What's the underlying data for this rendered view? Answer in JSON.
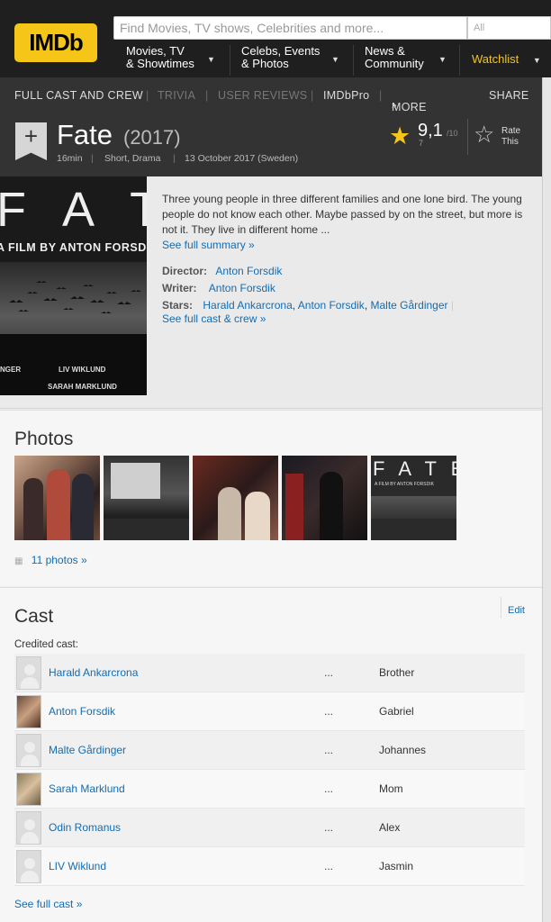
{
  "header": {
    "logo": "IMDb",
    "search_placeholder": "Find Movies, TV shows, Celebrities and more...",
    "search_category": "All",
    "nav": [
      {
        "line1": "Movies, TV",
        "line2": "& Showtimes"
      },
      {
        "line1": "Celebs, Events",
        "line2": "& Photos"
      },
      {
        "line1": "News &",
        "line2": "Community"
      }
    ],
    "watchlist": "Watchlist"
  },
  "subnav": {
    "full_cast": "FULL CAST AND CREW",
    "trivia": "TRIVIA",
    "user_reviews": "USER REVIEWS",
    "imdbpro": "IMDbPro",
    "more": "MORE",
    "share": "SHARE"
  },
  "title": {
    "name": "Fate",
    "year": "(2017)",
    "runtime": "16min",
    "genres": "Short, Drama",
    "release": "13 October 2017 (Sweden)",
    "rating": "9,1",
    "rating_max": "/10",
    "rating_count": "7",
    "rate_line1": "Rate",
    "rate_line2": "This"
  },
  "poster": {
    "title_letters": "F A T",
    "tagline": "A FILM BY ANTON FORSDI",
    "credit1": "NGER",
    "credit2": "LIV WIKLUND",
    "credit3": "SARAH MARKLUND"
  },
  "overview": {
    "summary": "Three young people in three different families and one lone bird. The young people do not know each other. Maybe passed by on the street, but more is not it. They live in different home ...",
    "see_summary": "See full summary »",
    "director_label": "Director:",
    "director": "Anton Forsdik",
    "writer_label": "Writer:",
    "writer": "Anton Forsdik",
    "stars_label": "Stars:",
    "stars": [
      "Harald Ankarcrona",
      "Anton Forsdik",
      "Malte Gårdinger"
    ],
    "see_cast": "See full cast & crew »"
  },
  "photos": {
    "heading": "Photos",
    "count_link": "11 photos",
    "poster_thumb_title": "F A T E",
    "poster_thumb_tagline": "A FILM BY ANTON FORSDIK"
  },
  "cast": {
    "heading": "Cast",
    "edit": "Edit",
    "credited": "Credited cast:",
    "rows": [
      {
        "name": "Harald Ankarcrona",
        "dots": "...",
        "character": "Brother"
      },
      {
        "name": "Anton Forsdik",
        "dots": "...",
        "character": "Gabriel"
      },
      {
        "name": "Malte Gårdinger",
        "dots": "...",
        "character": "Johannes"
      },
      {
        "name": "Sarah Marklund",
        "dots": "...",
        "character": "Mom"
      },
      {
        "name": "Odin Romanus",
        "dots": "...",
        "character": "Alex"
      },
      {
        "name": "LIV Wiklund",
        "dots": "...",
        "character": "Jasmin"
      }
    ],
    "see_full": "See full cast »"
  }
}
